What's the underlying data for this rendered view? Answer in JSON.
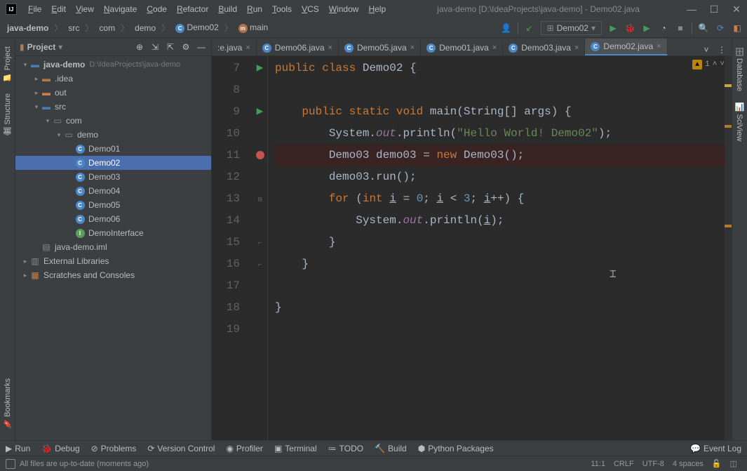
{
  "title": "java-demo [D:\\IdeaProjects\\java-demo] - Demo02.java",
  "menu": [
    "File",
    "Edit",
    "View",
    "Navigate",
    "Code",
    "Refactor",
    "Build",
    "Run",
    "Tools",
    "VCS",
    "Window",
    "Help"
  ],
  "breadcrumb": [
    {
      "label": "java-demo",
      "icon": "module"
    },
    {
      "label": "src",
      "icon": "folder"
    },
    {
      "label": "com",
      "icon": "pkg"
    },
    {
      "label": "demo",
      "icon": "pkg"
    },
    {
      "label": "Demo02",
      "icon": "class"
    },
    {
      "label": "main",
      "icon": "method"
    }
  ],
  "runConfig": "Demo02",
  "leftTabs": [
    "Project",
    "Structure"
  ],
  "leftBottomTab": "Bookmarks",
  "rightTabs": [
    "Database",
    "SciView"
  ],
  "projectPanel": {
    "title": "Project"
  },
  "tree": [
    {
      "depth": 0,
      "arrow": "▾",
      "icon": "module",
      "label": "java-demo",
      "hint": "D:\\IdeaProjects\\java-demo",
      "bold": true
    },
    {
      "depth": 1,
      "arrow": "▸",
      "icon": "folder",
      "label": ".idea"
    },
    {
      "depth": 1,
      "arrow": "▸",
      "icon": "folder-out",
      "label": "out"
    },
    {
      "depth": 1,
      "arrow": "▾",
      "icon": "folder-src",
      "label": "src"
    },
    {
      "depth": 2,
      "arrow": "▾",
      "icon": "pkg",
      "label": "com"
    },
    {
      "depth": 3,
      "arrow": "▾",
      "icon": "pkg",
      "label": "demo"
    },
    {
      "depth": 4,
      "arrow": "",
      "icon": "class",
      "label": "Demo01"
    },
    {
      "depth": 4,
      "arrow": "",
      "icon": "class",
      "label": "Demo02",
      "selected": true
    },
    {
      "depth": 4,
      "arrow": "",
      "icon": "class",
      "label": "Demo03"
    },
    {
      "depth": 4,
      "arrow": "",
      "icon": "class",
      "label": "Demo04"
    },
    {
      "depth": 4,
      "arrow": "",
      "icon": "class",
      "label": "Demo05"
    },
    {
      "depth": 4,
      "arrow": "",
      "icon": "class",
      "label": "Demo06"
    },
    {
      "depth": 4,
      "arrow": "",
      "icon": "interface",
      "label": "DemoInterface"
    },
    {
      "depth": 1,
      "arrow": "",
      "icon": "iml",
      "label": "java-demo.iml"
    },
    {
      "depth": 0,
      "arrow": "▸",
      "icon": "libs",
      "label": "External Libraries"
    },
    {
      "depth": 0,
      "arrow": "▸",
      "icon": "scratches",
      "label": "Scratches and Consoles"
    }
  ],
  "editorTabs": [
    {
      "label": ":e.java",
      "active": false,
      "hasClose": true,
      "noIcon": true
    },
    {
      "label": "Demo06.java",
      "active": false,
      "hasClose": true
    },
    {
      "label": "Demo05.java",
      "active": false,
      "hasClose": true
    },
    {
      "label": "Demo01.java",
      "active": false,
      "hasClose": true
    },
    {
      "label": "Demo03.java",
      "active": false,
      "hasClose": true
    },
    {
      "label": "Demo02.java",
      "active": true,
      "hasClose": true
    }
  ],
  "editorWarnings": {
    "count": "1"
  },
  "code": {
    "startLine": 7,
    "lines": [
      {
        "n": 7,
        "gutter": "play",
        "html": "<span class='kw'>public</span> <span class='kw'>class</span> <span class='cls'>Demo02</span> <span class='code-text'>{</span>"
      },
      {
        "n": 8,
        "gutter": "",
        "html": ""
      },
      {
        "n": 9,
        "gutter": "play",
        "fold": "-",
        "html": "    <span class='kw'>public</span> <span class='kw'>static</span> <span class='kw'>void</span> <span class='cls'>main</span><span class='code-text'>(String[] args) {</span>"
      },
      {
        "n": 10,
        "gutter": "",
        "html": "        <span class='code-text'>System.</span><span class='field'>out</span><span class='code-text'>.println(</span><span class='str'>\"Hello World! Demo02\"</span><span class='code-text'>);</span>"
      },
      {
        "n": 11,
        "gutter": "bp",
        "bp": true,
        "html": "        <span class='code-text'>Demo03 demo03 = </span><span class='kw'>new</span> <span class='code-text'>Demo03();</span>"
      },
      {
        "n": 12,
        "gutter": "",
        "html": "        <span class='code-text'>demo03.run();</span>"
      },
      {
        "n": 13,
        "gutter": "",
        "fold": "-",
        "html": "        <span class='kw'>for</span> <span class='code-text'>(</span><span class='kw'>int</span> <span class='code-text underline'>i</span><span class='code-text'> = </span><span class='num'>0</span><span class='code-text'>; <span class='underline'>i</span> &lt; </span><span class='num'>3</span><span class='code-text'>; <span class='underline'>i</span>++) {</span>"
      },
      {
        "n": 14,
        "gutter": "",
        "html": "            <span class='code-text'>System.</span><span class='field'>out</span><span class='code-text'>.println(<span class='underline'>i</span>);</span>"
      },
      {
        "n": 15,
        "gutter": "",
        "fold": "^",
        "html": "        <span class='code-text'>}</span>"
      },
      {
        "n": 16,
        "gutter": "",
        "fold": "^",
        "html": "    <span class='code-text'>}</span>"
      },
      {
        "n": 17,
        "gutter": "",
        "html": ""
      },
      {
        "n": 18,
        "gutter": "",
        "html": "<span class='code-text'>}</span>"
      },
      {
        "n": 19,
        "gutter": "",
        "html": ""
      }
    ]
  },
  "bottomTabs": [
    {
      "icon": "▶",
      "label": "Run"
    },
    {
      "icon": "🐞",
      "label": "Debug"
    },
    {
      "icon": "⊘",
      "label": "Problems"
    },
    {
      "icon": "⟳",
      "label": "Version Control"
    },
    {
      "icon": "◉",
      "label": "Profiler"
    },
    {
      "icon": "▣",
      "label": "Terminal"
    },
    {
      "icon": "≔",
      "label": "TODO"
    },
    {
      "icon": "🔨",
      "label": "Build"
    },
    {
      "icon": "⬢",
      "label": "Python Packages"
    }
  ],
  "eventLog": "Event Log",
  "status": {
    "msg": "All files are up-to-date (moments ago)",
    "pos": "11:1",
    "eol": "CRLF",
    "enc": "UTF-8",
    "indent": "4 spaces"
  }
}
